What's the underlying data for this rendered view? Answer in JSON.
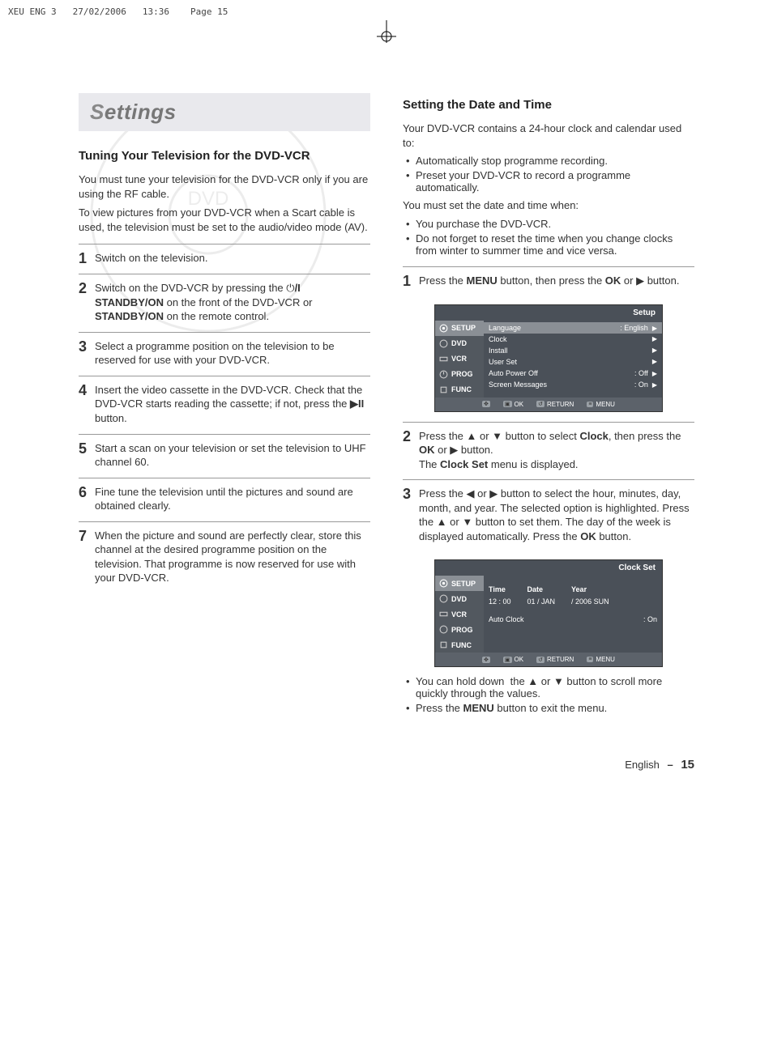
{
  "print_header": {
    "file": "XEU ENG 3",
    "date": "27/02/2006",
    "time": "13:36",
    "page": "Page 15"
  },
  "settings_label": "Settings",
  "left": {
    "section_title": "Tuning Your Television for the DVD-VCR",
    "intro1": "You must tune your television for the DVD-VCR only if you are using the RF cable.",
    "intro2": "To view pictures from your DVD-VCR when a Scart cable is used, the television must be set to the audio/video mode (AV).",
    "steps": [
      "Switch on the television.",
      "Switch on the DVD-VCR by pressing the ⏻/I STANDBY/ON on the front of the DVD-VCR or STANDBY/ON on the remote control.",
      "Select a programme position on the television to be reserved for use with your DVD-VCR.",
      "Insert the video cassette in the DVD-VCR. Check that the DVD-VCR starts reading the cassette; if not, press the ▶II button.",
      "Start a scan on your television or set the television to UHF channel 60.",
      "Fine tune the television until the pictures and sound are obtained clearly.",
      "When the picture and sound are perfectly clear, store this channel at the desired programme position on the television. That programme is now reserved for use with your DVD-VCR."
    ]
  },
  "right": {
    "section_title": "Setting the Date and Time",
    "intro_line": "Your DVD-VCR contains a 24-hour clock and calendar used to:",
    "intro_bullets": [
      "Automatically stop programme recording.",
      "Preset your DVD-VCR to record a programme automatically."
    ],
    "must_set_line": "You must set the date and time when:",
    "must_set_bullets": [
      "You purchase the DVD-VCR.",
      "Do not forget to reset the time when you change clocks from winter to summer time and vice versa."
    ],
    "step1": "Press the MENU button, then press the OK or ▶ button.",
    "step2": "Press the ▲ or ▼ button to select Clock, then press the OK or ▶ button. The Clock Set menu is displayed.",
    "step3": "Press the ◀ or ▶ button to select the hour, minutes, day, month, and year. The selected option is highlighted. Press the ▲ or ▼ button to set them. The day of the week is displayed automatically. Press the OK button.",
    "notes": [
      "You can hold down  the ▲ or ▼ button to scroll more quickly through the values.",
      "Press the MENU button to exit the menu."
    ]
  },
  "osd_setup": {
    "title": "Setup",
    "side": [
      "SETUP",
      "DVD",
      "VCR",
      "PROG",
      "FUNC"
    ],
    "rows": [
      {
        "label": "Language",
        "value": ": English",
        "hl": true
      },
      {
        "label": "Clock",
        "value": ""
      },
      {
        "label": "Install",
        "value": ""
      },
      {
        "label": "User Set",
        "value": ""
      },
      {
        "label": "Auto Power Off",
        "value": ": Off"
      },
      {
        "label": "Screen Messages",
        "value": ": On"
      }
    ],
    "footer": {
      "ok": "OK",
      "return": "RETURN",
      "menu": "MENU"
    }
  },
  "osd_clock": {
    "title": "Clock Set",
    "side": [
      "SETUP",
      "DVD",
      "VCR",
      "PROG",
      "FUNC"
    ],
    "headers": {
      "time": "Time",
      "date": "Date",
      "year": "Year"
    },
    "values": {
      "time": "12 : 00",
      "date": "01 / JAN",
      "year": "/ 2006 SUN"
    },
    "auto_clock_label": "Auto Clock",
    "auto_clock_value": ": On",
    "footer": {
      "ok": "OK",
      "return": "RETURN",
      "menu": "MENU"
    }
  },
  "footer": {
    "lang": "English",
    "dash": "–",
    "page": "15"
  }
}
